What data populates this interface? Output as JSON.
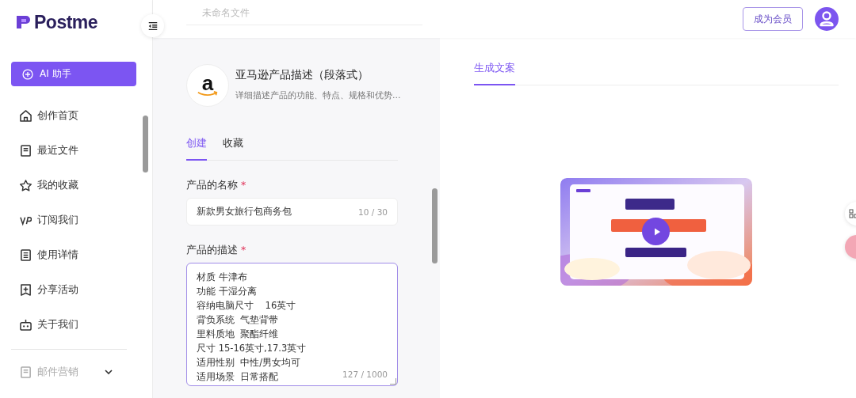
{
  "logo": {
    "text": "Postme"
  },
  "topbar": {
    "title_field": {
      "placeholder": "未命名文件"
    },
    "member_button": "成为会员"
  },
  "sidebar": {
    "assistant_button": "AI 助手",
    "items": [
      {
        "label": "创作首页",
        "kind": "home"
      },
      {
        "label": "最近文件",
        "kind": "file"
      },
      {
        "label": "我的收藏",
        "kind": "star"
      },
      {
        "label": "订阅我们",
        "kind": "vip"
      },
      {
        "label": "使用详情",
        "kind": "list"
      },
      {
        "label": "分享活动",
        "kind": "share"
      },
      {
        "label": "关于我们",
        "kind": "robot"
      }
    ],
    "group": {
      "label": "邮件营销",
      "kind": "mail",
      "expanded": false
    }
  },
  "template": {
    "logo_letter": "a",
    "title": "亚马逊产品描述（段落式）",
    "description": "详细描述产品的功能、特点、规格和优势...",
    "tabs": [
      {
        "label": "创建",
        "selected": true
      },
      {
        "label": "收藏",
        "selected": false
      }
    ],
    "fields": [
      {
        "kind": "input",
        "label": "产品的名称",
        "required_mark": "*",
        "lines": [
          "新款男女旅行包商务包"
        ],
        "count": "10 / 30",
        "focused": false
      },
      {
        "kind": "textarea",
        "label": "产品的描述",
        "required_mark": "*",
        "lines": [
          "材质 牛津布",
          "功能 干湿分离",
          "容纳电脑尺寸    16英寸",
          "背负系统  气垫背带",
          "里料质地  聚酯纤维",
          "尺寸 15-16英寸,17.3英寸",
          "适用性别  中性/男女均可",
          "适用场景  日常搭配"
        ],
        "count": "127 / 1000",
        "focused": true
      }
    ]
  },
  "output": {
    "tabs": [
      {
        "label": "生成文案",
        "selected": true
      }
    ]
  }
}
